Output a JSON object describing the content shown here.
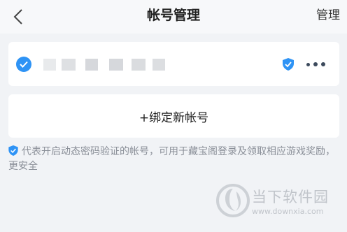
{
  "header": {
    "title": "帐号管理",
    "manage_label": "管理"
  },
  "account": {
    "masked_name": "",
    "verified": true,
    "secure_code_enabled": true
  },
  "add_account": {
    "label": "+绑定新帐号"
  },
  "notice": {
    "text": "代表开启动态密码验证的帐号，可用于藏宝阁登录及领取相应游戏奖励，更安全"
  },
  "watermark": {
    "name": "当下软件园",
    "url": "www.downxia.com"
  },
  "colors": {
    "accent_blue": "#2e93f5",
    "background": "#f1f3f6",
    "text_primary": "#1f1f1f",
    "text_secondary": "#8a8f98"
  }
}
